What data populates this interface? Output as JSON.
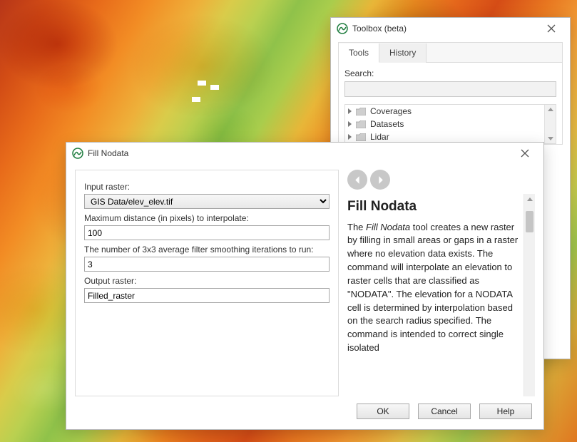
{
  "toolbox": {
    "title": "Toolbox (beta)",
    "tabs": {
      "tools": "Tools",
      "history": "History"
    },
    "search_label": "Search:",
    "search_value": "",
    "tree_items": [
      "Coverages",
      "Datasets",
      "Lidar"
    ]
  },
  "dialog": {
    "title": "Fill Nodata",
    "fields": {
      "input_raster": {
        "label": "Input raster:",
        "value": "GIS Data/elev_elev.tif"
      },
      "max_distance": {
        "label": "Maximum distance (in pixels) to interpolate:",
        "value": "100"
      },
      "iterations": {
        "label": "The number of 3x3 average filter smoothing iterations to run:",
        "value": "3"
      },
      "output_raster": {
        "label": "Output raster:",
        "value": "Filled_raster"
      }
    },
    "buttons": {
      "ok": "OK",
      "cancel": "Cancel",
      "help": "Help"
    },
    "help": {
      "heading": "Fill Nodata",
      "body_prefix": "The ",
      "body_em": "Fill Nodata",
      "body_rest": " tool creates a new raster by filling in small areas or gaps in a raster where no elevation data exists. The command will interpolate an elevation to raster cells that are classified as \"NODATA\". The elevation for a NODATA cell is determined by interpolation based on the search radius specified. The command is intended to correct single isolated"
    }
  }
}
